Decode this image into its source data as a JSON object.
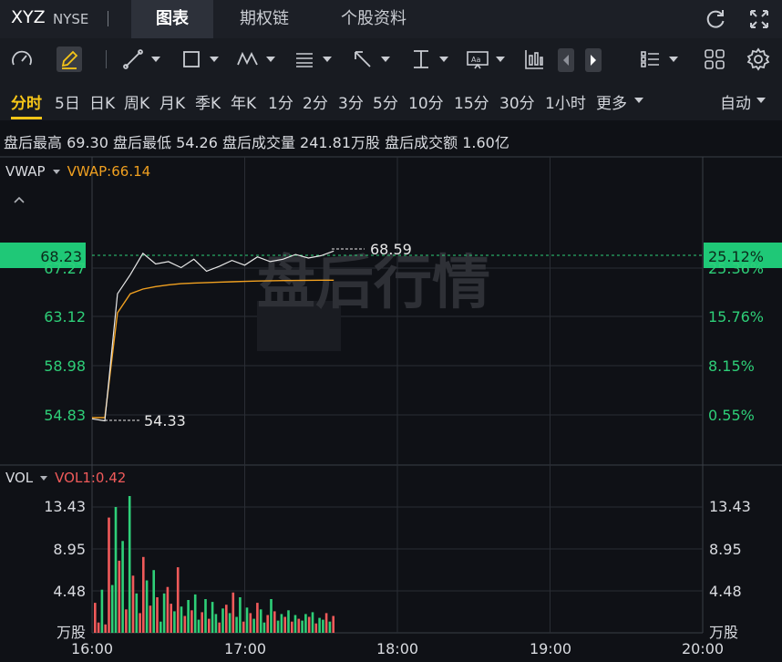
{
  "header": {
    "ticker": "XYZ",
    "exchange": "NYSE",
    "tabs": [
      {
        "label": "图表",
        "active": true
      },
      {
        "label": "期权链",
        "active": false
      },
      {
        "label": "个股资料",
        "active": false
      }
    ]
  },
  "toolbar": {
    "tools": [
      "gauge-icon",
      "pencil-icon",
      "line-tool-icon",
      "rectangle-tool-icon",
      "wave-tool-icon",
      "fibonacci-tool-icon",
      "arrow-tool-icon",
      "text-height-icon",
      "text-tool-icon",
      "candlestick-icon",
      "left-arrow-icon",
      "right-arrow-icon",
      "list-layout-icon",
      "grid-layout-icon",
      "settings-icon"
    ]
  },
  "periods": {
    "items": [
      "分时",
      "5日",
      "日K",
      "周K",
      "月K",
      "季K",
      "年K",
      "1分",
      "2分",
      "3分",
      "5分",
      "10分",
      "15分",
      "30分",
      "1小时",
      "更多"
    ],
    "active": "分时",
    "auto": "自动"
  },
  "stats": {
    "text": "盘后最高 69.30 盘后最低 54.26 盘后成交量 241.81万股 盘后成交额 1.60亿"
  },
  "price_panel": {
    "indicator": "VWAP",
    "vwap_label": "VWAP:66.14",
    "current_price": "68.23",
    "current_pct": "25.12%",
    "y_labels": [
      "67.27",
      "63.12",
      "58.98",
      "54.83"
    ],
    "pct_labels": [
      "25.36%",
      "15.76%",
      "8.15%",
      "0.55%"
    ],
    "high_marker": "68.59",
    "low_marker": "54.33",
    "watermark": "盘后行情"
  },
  "volume_panel": {
    "indicator": "VOL",
    "vol_label": "VOL1:0.42",
    "y_labels": [
      "13.43",
      "8.95",
      "4.48"
    ],
    "unit": "万股"
  },
  "x_axis": [
    "16:00",
    "17:00",
    "18:00",
    "19:00",
    "20:00"
  ],
  "colors": {
    "up": "#2ecf78",
    "down": "#f05a5a",
    "vwap": "#f0a020",
    "accent": "#f5c518",
    "price_line": "#e8e8e8"
  },
  "chart_data": {
    "type": "line",
    "x": [
      "16:00",
      "16:05",
      "16:10",
      "16:15",
      "16:20",
      "16:25",
      "16:30",
      "16:35",
      "16:40",
      "16:45",
      "16:50",
      "16:55",
      "17:00",
      "17:05",
      "17:10",
      "17:15",
      "17:20",
      "17:25",
      "17:30",
      "17:35"
    ],
    "series": [
      {
        "name": "",
        "values": [
          54.5,
          54.33,
          65.0,
          66.6,
          68.4,
          67.5,
          67.7,
          67.2,
          67.9,
          66.9,
          67.3,
          67.8,
          67.4,
          68.1,
          67.7,
          67.9,
          68.3,
          68.0,
          68.2,
          68.59
        ]
      },
      {
        "name": "VWAP",
        "values": [
          54.6,
          54.6,
          63.4,
          65.0,
          65.4,
          65.6,
          65.75,
          65.85,
          65.9,
          65.94,
          65.98,
          66.01,
          66.04,
          66.07,
          66.09,
          66.11,
          66.12,
          66.13,
          66.14,
          66.14
        ]
      }
    ],
    "volume": {
      "unit": "万股",
      "values": [
        3.2,
        1.1,
        4.6,
        0.9,
        12.3,
        5.1,
        13.43,
        7.7,
        9.8,
        2.5,
        14.6,
        6.1,
        4.2,
        2.1,
        8.1,
        5.6,
        2.9,
        6.7,
        3.8,
        1.2,
        4.2,
        4.9,
        3.1,
        2.3,
        7.0,
        2.8,
        1.8,
        3.5,
        2.4,
        4.1,
        1.4,
        2.2,
        3.6,
        1.5,
        3.3,
        2.0,
        1.1,
        2.6,
        3.0,
        2.1,
        4.3,
        1.7,
        3.8,
        1.2,
        2.7,
        2.1,
        1.5,
        3.2,
        2.5,
        1.1,
        1.9,
        3.6,
        2.3,
        1.3,
        2.0,
        1.7,
        2.4,
        1.2,
        1.9,
        1.5,
        1.3,
        2.0,
        1.7,
        2.2,
        1.0,
        1.6,
        1.4,
        2.1,
        1.2,
        1.8
      ],
      "up": [
        false,
        false,
        true,
        false,
        false,
        true,
        true,
        false,
        true,
        false,
        true,
        false,
        true,
        false,
        false,
        true,
        false,
        true,
        false,
        true,
        true,
        false,
        false,
        true,
        false,
        true,
        false,
        true,
        false,
        true,
        true,
        false,
        true,
        false,
        true,
        true,
        false,
        true,
        false,
        true,
        false,
        true,
        true,
        false,
        true,
        false,
        true,
        false,
        true,
        true,
        false,
        true,
        false,
        true,
        true,
        false,
        true,
        false,
        true,
        false,
        true,
        true,
        false,
        true,
        false,
        true,
        true,
        false,
        true,
        false
      ],
      "ylim": [
        0,
        13.43
      ]
    },
    "ylim": [
      54.83,
      68.23
    ],
    "xlim": [
      "16:00",
      "20:00"
    ]
  }
}
